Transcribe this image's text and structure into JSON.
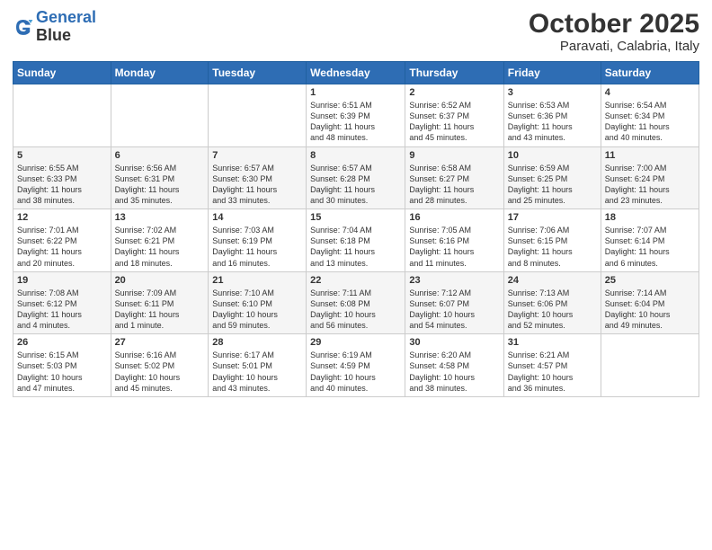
{
  "logo": {
    "line1": "General",
    "line2": "Blue"
  },
  "title": "October 2025",
  "subtitle": "Paravati, Calabria, Italy",
  "days_of_week": [
    "Sunday",
    "Monday",
    "Tuesday",
    "Wednesday",
    "Thursday",
    "Friday",
    "Saturday"
  ],
  "weeks": [
    [
      {
        "day": "",
        "info": ""
      },
      {
        "day": "",
        "info": ""
      },
      {
        "day": "",
        "info": ""
      },
      {
        "day": "1",
        "info": "Sunrise: 6:51 AM\nSunset: 6:39 PM\nDaylight: 11 hours\nand 48 minutes."
      },
      {
        "day": "2",
        "info": "Sunrise: 6:52 AM\nSunset: 6:37 PM\nDaylight: 11 hours\nand 45 minutes."
      },
      {
        "day": "3",
        "info": "Sunrise: 6:53 AM\nSunset: 6:36 PM\nDaylight: 11 hours\nand 43 minutes."
      },
      {
        "day": "4",
        "info": "Sunrise: 6:54 AM\nSunset: 6:34 PM\nDaylight: 11 hours\nand 40 minutes."
      }
    ],
    [
      {
        "day": "5",
        "info": "Sunrise: 6:55 AM\nSunset: 6:33 PM\nDaylight: 11 hours\nand 38 minutes."
      },
      {
        "day": "6",
        "info": "Sunrise: 6:56 AM\nSunset: 6:31 PM\nDaylight: 11 hours\nand 35 minutes."
      },
      {
        "day": "7",
        "info": "Sunrise: 6:57 AM\nSunset: 6:30 PM\nDaylight: 11 hours\nand 33 minutes."
      },
      {
        "day": "8",
        "info": "Sunrise: 6:57 AM\nSunset: 6:28 PM\nDaylight: 11 hours\nand 30 minutes."
      },
      {
        "day": "9",
        "info": "Sunrise: 6:58 AM\nSunset: 6:27 PM\nDaylight: 11 hours\nand 28 minutes."
      },
      {
        "day": "10",
        "info": "Sunrise: 6:59 AM\nSunset: 6:25 PM\nDaylight: 11 hours\nand 25 minutes."
      },
      {
        "day": "11",
        "info": "Sunrise: 7:00 AM\nSunset: 6:24 PM\nDaylight: 11 hours\nand 23 minutes."
      }
    ],
    [
      {
        "day": "12",
        "info": "Sunrise: 7:01 AM\nSunset: 6:22 PM\nDaylight: 11 hours\nand 20 minutes."
      },
      {
        "day": "13",
        "info": "Sunrise: 7:02 AM\nSunset: 6:21 PM\nDaylight: 11 hours\nand 18 minutes."
      },
      {
        "day": "14",
        "info": "Sunrise: 7:03 AM\nSunset: 6:19 PM\nDaylight: 11 hours\nand 16 minutes."
      },
      {
        "day": "15",
        "info": "Sunrise: 7:04 AM\nSunset: 6:18 PM\nDaylight: 11 hours\nand 13 minutes."
      },
      {
        "day": "16",
        "info": "Sunrise: 7:05 AM\nSunset: 6:16 PM\nDaylight: 11 hours\nand 11 minutes."
      },
      {
        "day": "17",
        "info": "Sunrise: 7:06 AM\nSunset: 6:15 PM\nDaylight: 11 hours\nand 8 minutes."
      },
      {
        "day": "18",
        "info": "Sunrise: 7:07 AM\nSunset: 6:14 PM\nDaylight: 11 hours\nand 6 minutes."
      }
    ],
    [
      {
        "day": "19",
        "info": "Sunrise: 7:08 AM\nSunset: 6:12 PM\nDaylight: 11 hours\nand 4 minutes."
      },
      {
        "day": "20",
        "info": "Sunrise: 7:09 AM\nSunset: 6:11 PM\nDaylight: 11 hours\nand 1 minute."
      },
      {
        "day": "21",
        "info": "Sunrise: 7:10 AM\nSunset: 6:10 PM\nDaylight: 10 hours\nand 59 minutes."
      },
      {
        "day": "22",
        "info": "Sunrise: 7:11 AM\nSunset: 6:08 PM\nDaylight: 10 hours\nand 56 minutes."
      },
      {
        "day": "23",
        "info": "Sunrise: 7:12 AM\nSunset: 6:07 PM\nDaylight: 10 hours\nand 54 minutes."
      },
      {
        "day": "24",
        "info": "Sunrise: 7:13 AM\nSunset: 6:06 PM\nDaylight: 10 hours\nand 52 minutes."
      },
      {
        "day": "25",
        "info": "Sunrise: 7:14 AM\nSunset: 6:04 PM\nDaylight: 10 hours\nand 49 minutes."
      }
    ],
    [
      {
        "day": "26",
        "info": "Sunrise: 6:15 AM\nSunset: 5:03 PM\nDaylight: 10 hours\nand 47 minutes."
      },
      {
        "day": "27",
        "info": "Sunrise: 6:16 AM\nSunset: 5:02 PM\nDaylight: 10 hours\nand 45 minutes."
      },
      {
        "day": "28",
        "info": "Sunrise: 6:17 AM\nSunset: 5:01 PM\nDaylight: 10 hours\nand 43 minutes."
      },
      {
        "day": "29",
        "info": "Sunrise: 6:19 AM\nSunset: 4:59 PM\nDaylight: 10 hours\nand 40 minutes."
      },
      {
        "day": "30",
        "info": "Sunrise: 6:20 AM\nSunset: 4:58 PM\nDaylight: 10 hours\nand 38 minutes."
      },
      {
        "day": "31",
        "info": "Sunrise: 6:21 AM\nSunset: 4:57 PM\nDaylight: 10 hours\nand 36 minutes."
      },
      {
        "day": "",
        "info": ""
      }
    ]
  ]
}
